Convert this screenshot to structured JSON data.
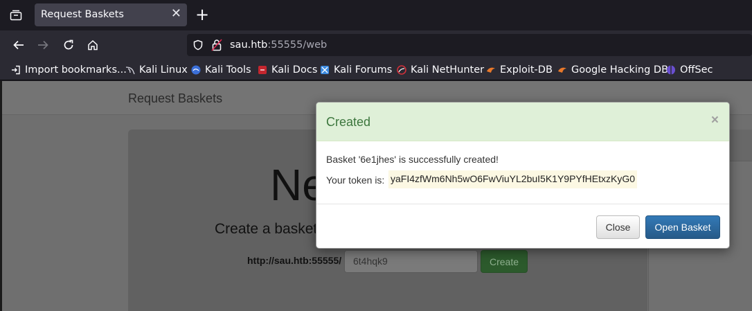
{
  "browser": {
    "tab_title": "Request Baskets",
    "url_host": "sau.htb",
    "url_rest": ":55555/web"
  },
  "bookmarks": [
    {
      "label": "Import bookmarks...",
      "icon": "import-icon"
    },
    {
      "label": "Kali Linux",
      "icon": "kali-dragon-icon"
    },
    {
      "label": "Kali Tools",
      "icon": "kali-tools-icon"
    },
    {
      "label": "Kali Docs",
      "icon": "kali-docs-icon"
    },
    {
      "label": "Kali Forums",
      "icon": "kali-forums-icon"
    },
    {
      "label": "Kali NetHunter",
      "icon": "nethunter-icon"
    },
    {
      "label": "Exploit-DB",
      "icon": "exploit-db-icon"
    },
    {
      "label": "Google Hacking DB",
      "icon": "ghdb-icon"
    },
    {
      "label": "OffSec",
      "icon": "offsec-icon"
    }
  ],
  "site": {
    "brand": "Request Baskets",
    "headline": "Ne",
    "subtitle": "Create a basket",
    "base_url": "http://sau.htb:55555/",
    "basket_name_value": "6t4hqk9",
    "create_label": "Create"
  },
  "modal": {
    "title": "Created",
    "close_x": "×",
    "message": "Basket '6e1jhes' is successfully created!",
    "token_label": "Your token is:",
    "token": "yaFI4zfWm6Nh5wO6FwViuYL2buI5K1Y9PYfHEtxzKyG0",
    "close_label": "Close",
    "open_label": "Open Basket"
  },
  "colors": {
    "success_header": "#dff0d8",
    "success_text": "#3c763d",
    "primary": "#337ab7",
    "token_bg": "#fcf8e3"
  }
}
